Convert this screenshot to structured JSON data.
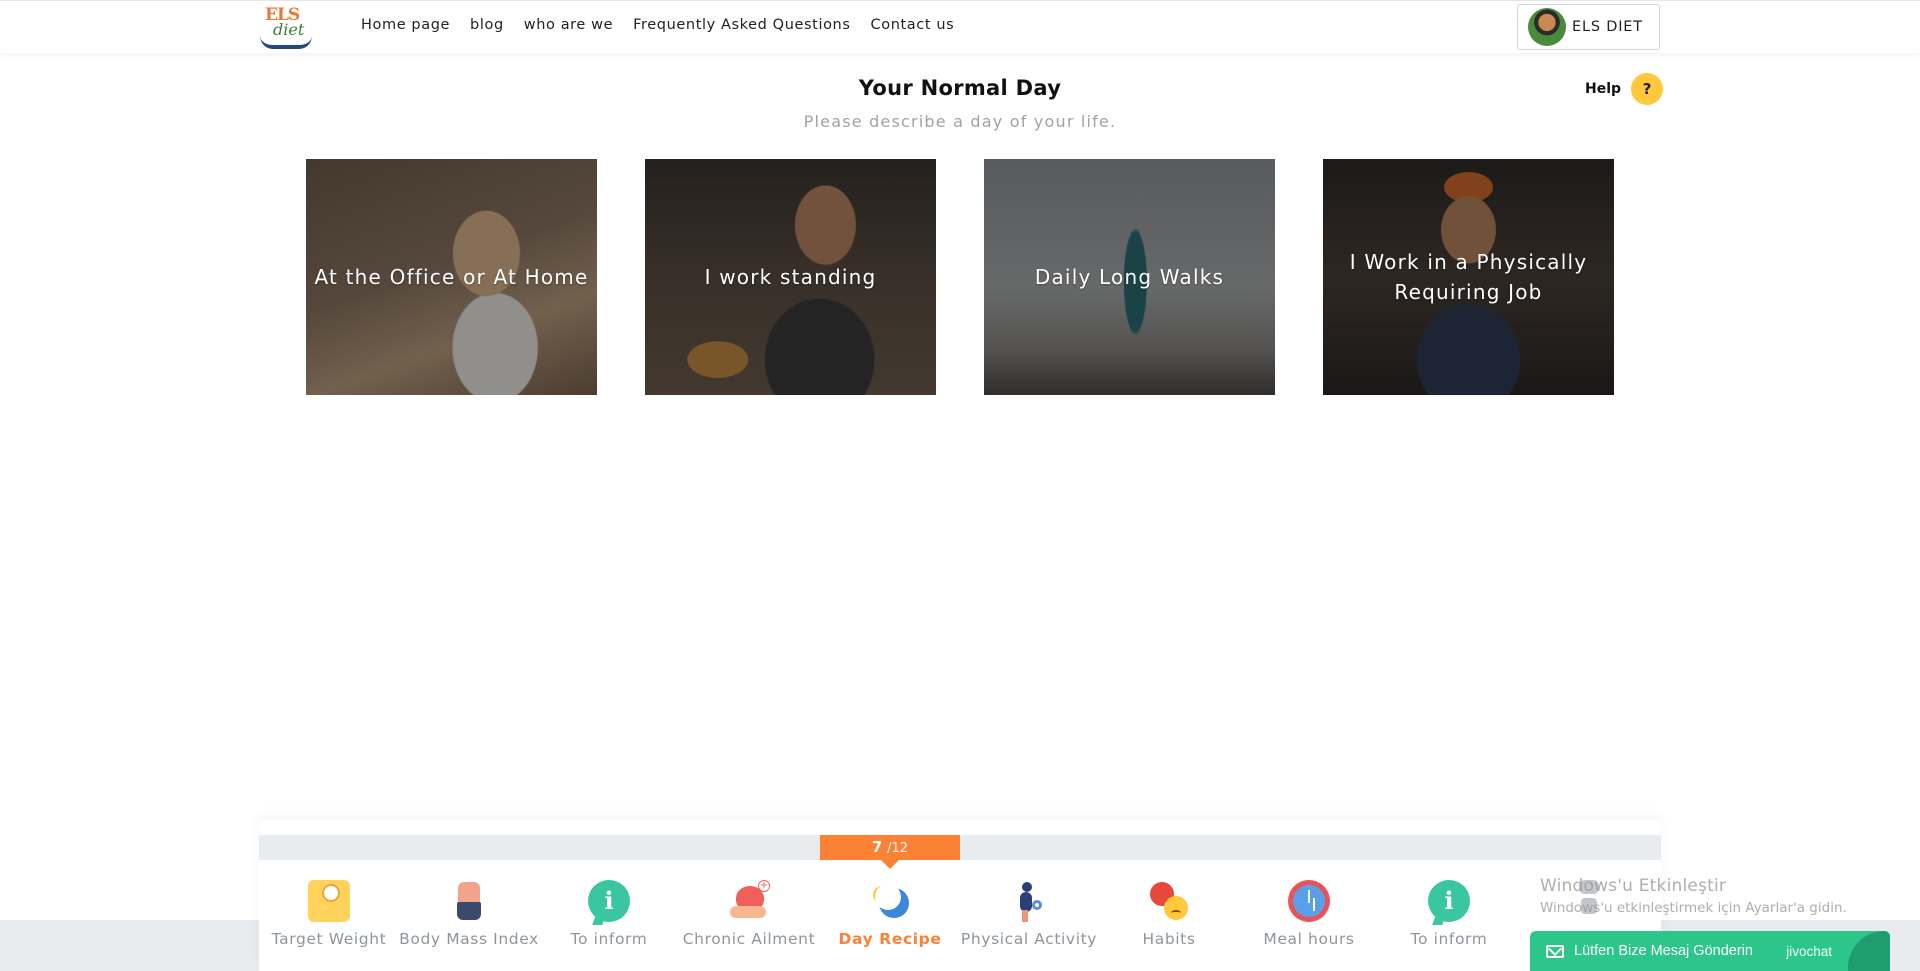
{
  "brand": {
    "logo_top": "ELS",
    "logo_bottom": "diet"
  },
  "nav": {
    "items": [
      {
        "label": "Home page"
      },
      {
        "label": "blog"
      },
      {
        "label": "who are we"
      },
      {
        "label": "Frequently Asked Questions"
      },
      {
        "label": "Contact us"
      }
    ]
  },
  "user": {
    "name": "ELS DIET"
  },
  "question": {
    "title": "Your Normal Day",
    "subtitle": "Please describe a day of your life.",
    "help_label": "Help",
    "help_icon": "?"
  },
  "options": [
    {
      "label": "At the Office or At Home",
      "image_icon": "woman-phone-laptop-photo"
    },
    {
      "label": "I work standing",
      "image_icon": "barista-photo"
    },
    {
      "label": "Daily Long Walks",
      "image_icon": "man-walking-photo"
    },
    {
      "label": "I Work in a Physically Requiring Job",
      "image_icon": "worker-hardhat-photo"
    }
  ],
  "progress": {
    "current": "7",
    "total": "/12",
    "current_value": 7,
    "total_value": 12,
    "steps": [
      {
        "label": "Target Weight",
        "icon": "scale-icon"
      },
      {
        "label": "Body Mass Index",
        "icon": "body-icon"
      },
      {
        "label": "To inform",
        "icon": "info-icon"
      },
      {
        "label": "Chronic Ailment",
        "icon": "heart-hand-icon"
      },
      {
        "label": "Day Recipe",
        "icon": "sun-moon-icon",
        "active": true
      },
      {
        "label": "Physical Activity",
        "icon": "exercise-icon"
      },
      {
        "label": "Habits",
        "icon": "faces-icon"
      },
      {
        "label": "Meal hours",
        "icon": "clock-icon"
      },
      {
        "label": "To inform",
        "icon": "info-icon"
      }
    ]
  },
  "windows_watermark": {
    "line1": "Windows'u Etkinleştir",
    "line2": "Windows'u etkinleştirmek için Ayarlar'a gidin."
  },
  "chat": {
    "label": "Lütfen Bize Mesaj Gönderin",
    "brand": "jivochat"
  },
  "colors": {
    "accent": "#fb8234",
    "help_yellow": "#ffc83d",
    "chat_green": "#2cc58a",
    "step_gray": "#8e969c"
  }
}
